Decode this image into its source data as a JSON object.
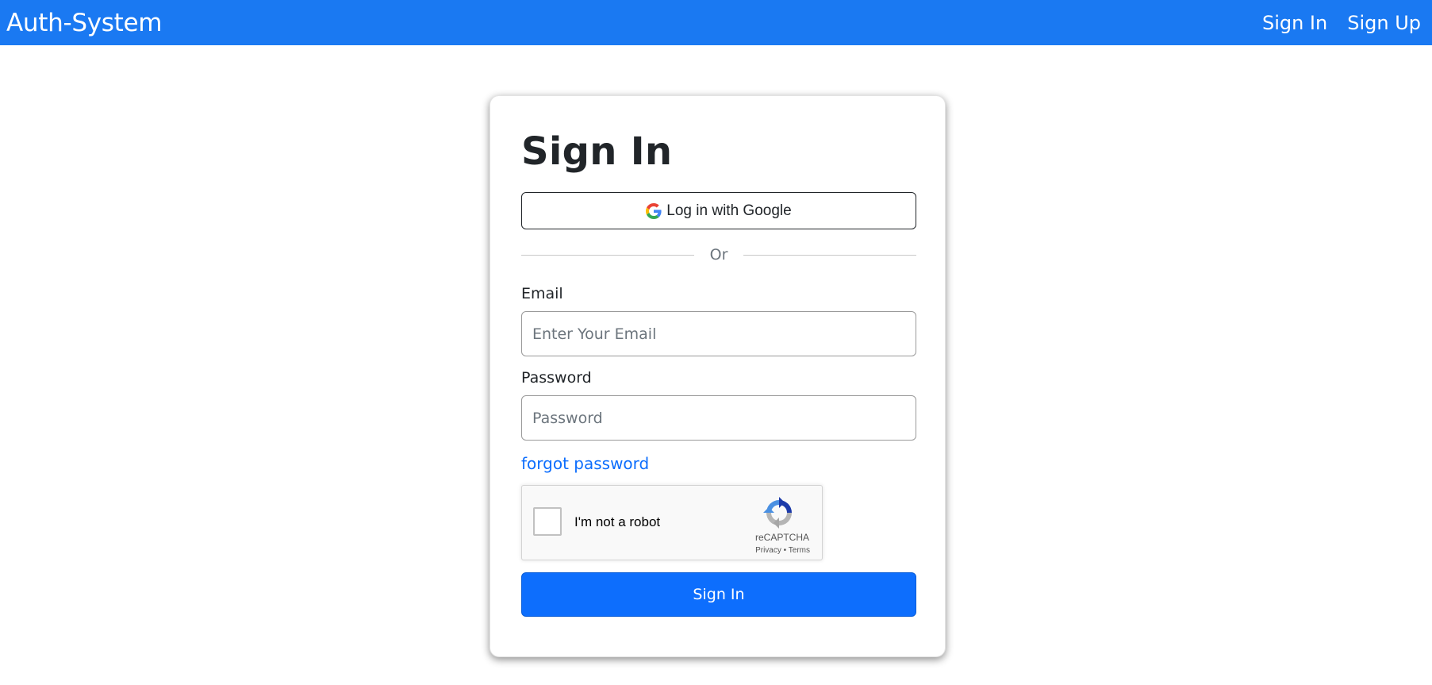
{
  "navbar": {
    "brand": "Auth-System",
    "links": [
      "Sign In",
      "Sign Up"
    ],
    "color": "#1a79f2"
  },
  "form": {
    "title": "Sign In",
    "google_button": {
      "label": "Log in with Google",
      "icon": "google-g-icon"
    },
    "divider_text": "Or",
    "email": {
      "label": "Email",
      "placeholder": "Enter Your Email",
      "value": ""
    },
    "password": {
      "label": "Password",
      "placeholder": "Password",
      "value": ""
    },
    "forgot_password": "forgot password",
    "recaptcha": {
      "label": "I'm not a robot",
      "brand": "reCAPTCHA",
      "privacy": "Privacy",
      "separator": "•",
      "terms": "Terms",
      "icon": "recaptcha-logo-icon"
    },
    "submit_label": "Sign In",
    "submit_color": "#0d6efd"
  }
}
